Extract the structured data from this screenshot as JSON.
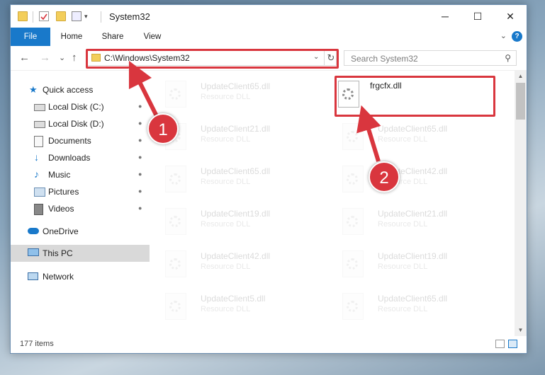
{
  "window": {
    "title": "System32",
    "minimize_glyph": "─",
    "maximize_glyph": "☐",
    "close_glyph": "✕"
  },
  "ribbon": {
    "tabs": [
      "File",
      "Home",
      "Share",
      "View"
    ],
    "help_glyph": "?",
    "expand_glyph": "⌄"
  },
  "nav": {
    "back_glyph": "←",
    "forward_glyph": "→",
    "recent_glyph": "⌄",
    "up_glyph": "↑",
    "address": "C:\\Windows\\System32",
    "address_dropdown_glyph": "⌄",
    "refresh_glyph": "↻",
    "search_placeholder": "Search System32",
    "search_glyph": "⚲"
  },
  "sidebar": {
    "items": [
      {
        "label": "Quick access",
        "icon": "star-icon",
        "pinned": false
      },
      {
        "label": "Local Disk (C:)",
        "icon": "drive-icon",
        "pinned": true
      },
      {
        "label": "Local Disk (D:)",
        "icon": "drive-icon",
        "pinned": true
      },
      {
        "label": "Documents",
        "icon": "documents-icon",
        "pinned": true
      },
      {
        "label": "Downloads",
        "icon": "download-arrow-icon",
        "pinned": true
      },
      {
        "label": "Music",
        "icon": "music-note-icon",
        "pinned": true
      },
      {
        "label": "Pictures",
        "icon": "pictures-icon",
        "pinned": true
      },
      {
        "label": "Videos",
        "icon": "videos-icon",
        "pinned": true
      },
      {
        "label": "OneDrive",
        "icon": "cloud-icon",
        "pinned": false
      },
      {
        "label": "This PC",
        "icon": "monitor-icon",
        "pinned": false,
        "selected": true
      },
      {
        "label": "Network",
        "icon": "network-icon",
        "pinned": false
      }
    ],
    "pin_glyph": "📌"
  },
  "files": {
    "left_column": [
      {
        "name": "UpdateClient65.dll",
        "type": "Resource DLL"
      },
      {
        "name": "UpdateClient21.dll",
        "type": "Resource DLL"
      },
      {
        "name": "UpdateClient65.dll",
        "type": "Resource DLL"
      },
      {
        "name": "UpdateClient19.dll",
        "type": "Resource DLL"
      },
      {
        "name": "UpdateClient42.dll",
        "type": "Resource DLL"
      },
      {
        "name": "UpdateClient5.dll",
        "type": "Resource DLL"
      }
    ],
    "right_column": [
      {
        "name": "frgcfx.dll",
        "type": "",
        "highlighted": true
      },
      {
        "name": "UpdateClient65.dll",
        "type": "Resource DLL"
      },
      {
        "name": "UpdateClient42.dll",
        "type": "Resource DLL"
      },
      {
        "name": "UpdateClient21.dll",
        "type": "Resource DLL"
      },
      {
        "name": "UpdateClient19.dll",
        "type": "Resource DLL"
      },
      {
        "name": "UpdateClient65.dll",
        "type": "Resource DLL"
      }
    ]
  },
  "status": {
    "item_count": "177 items"
  },
  "callouts": {
    "one": "1",
    "two": "2"
  },
  "colors": {
    "accent": "#1979ca",
    "highlight": "#d9363e",
    "folder": "#f3ce5b"
  }
}
